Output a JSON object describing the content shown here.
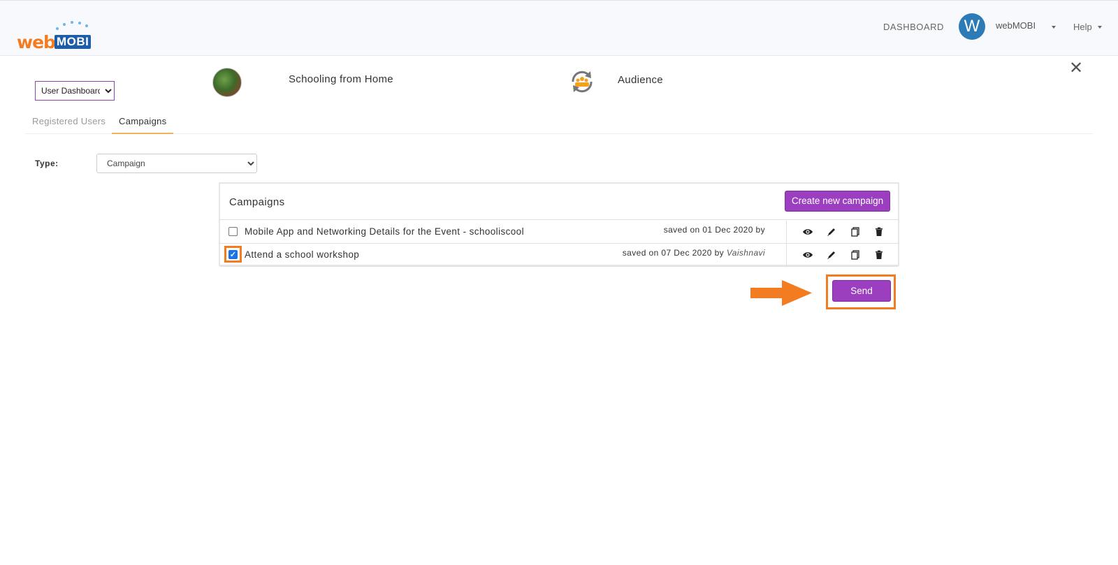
{
  "header": {
    "logo": {
      "part1": "web",
      "part2": "MOBI"
    },
    "nav_dashboard": "DASHBOARD",
    "avatar_letter": "W",
    "username": "webMOBI",
    "help": "Help"
  },
  "toolbar": {
    "dashboard_select": {
      "selected": "User Dashboard"
    },
    "project_name": "Schooling from Home",
    "section_name": "Audience",
    "close_symbol": "✕"
  },
  "tabs": [
    {
      "label": "Registered Users",
      "active": false
    },
    {
      "label": "Campaigns",
      "active": true
    }
  ],
  "filter": {
    "type_label": "Type:",
    "type_selected": "Campaign"
  },
  "campaigns_panel": {
    "title": "Campaigns",
    "create_button": "Create new campaign",
    "rows": [
      {
        "checked": false,
        "name": "Mobile App and Networking Details for the Event - schooliscool",
        "saved_prefix": "saved on 01 Dec 2020 by",
        "author": ""
      },
      {
        "checked": true,
        "name": "Attend a school workshop",
        "saved_prefix": "saved on 07 Dec 2020 by",
        "author": "Vaishnavi"
      }
    ],
    "row_actions": [
      "eye-icon",
      "pencil-icon",
      "copy-icon",
      "trash-icon"
    ]
  },
  "send_button": "Send",
  "colors": {
    "accent_purple": "#9b3fc0",
    "highlight_orange": "#f47c20",
    "avatar_blue": "#2c7bb6"
  }
}
